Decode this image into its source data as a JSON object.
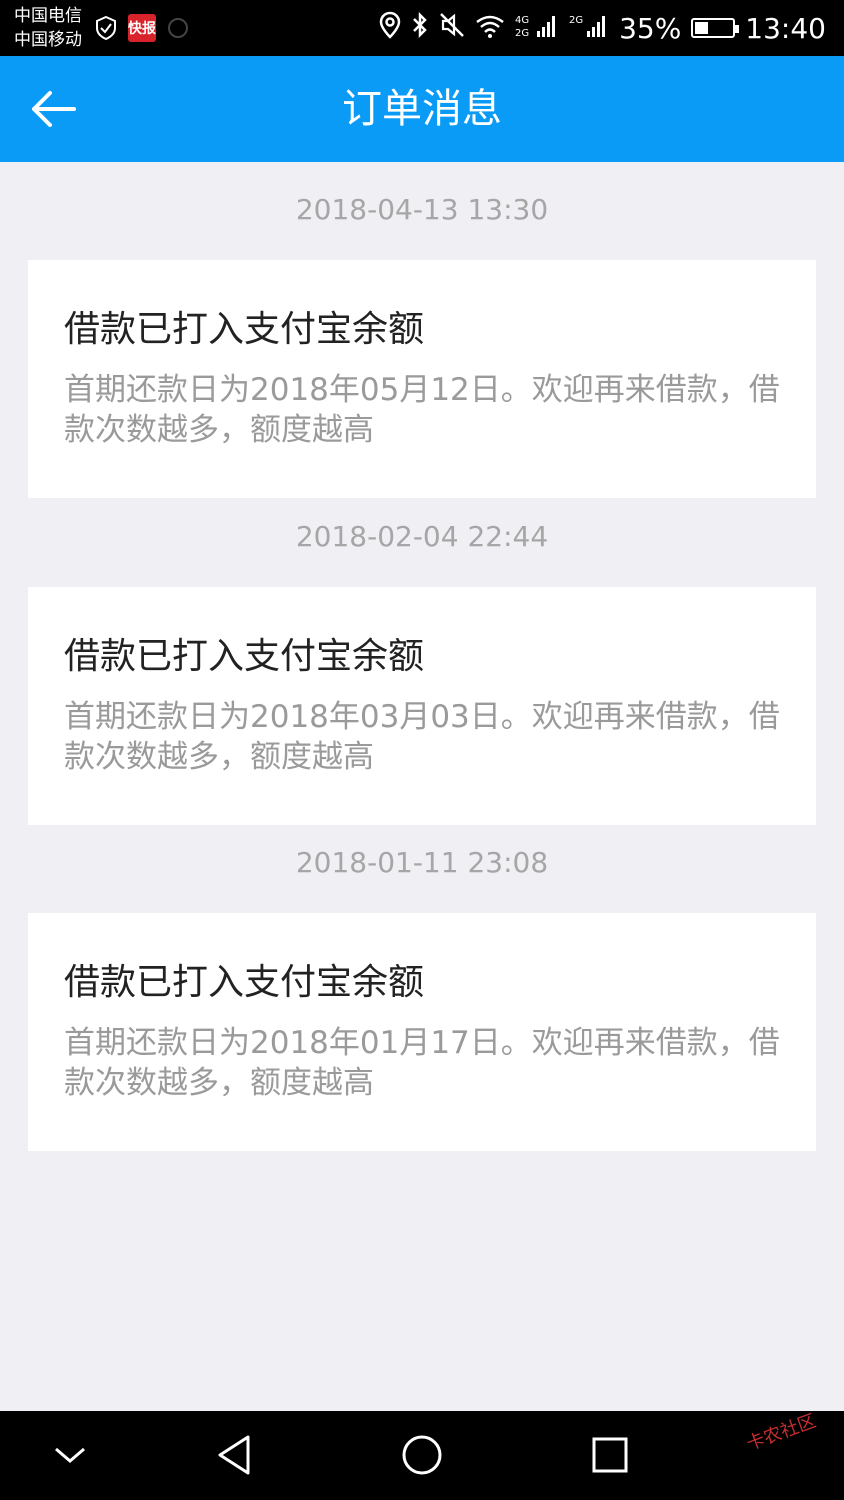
{
  "status_bar": {
    "carrier1": "中国电信",
    "carrier2": "中国移动",
    "app_badge": "快报",
    "battery_text": "35%",
    "battery_level": 0.35,
    "time": "13:40",
    "signal1_label": "4G 2G",
    "signal2_label": "2G"
  },
  "header": {
    "title": "订单消息",
    "background_color": "#0a9bf6"
  },
  "messages": [
    {
      "time": "2018-04-13 13:30",
      "title": "借款已打入支付宝余额",
      "body": "首期还款日为2018年05月12日。欢迎再来借款，借款次数越多，额度越高"
    },
    {
      "time": "2018-02-04 22:44",
      "title": "借款已打入支付宝余额",
      "body": "首期还款日为2018年03月03日。欢迎再来借款，借款次数越多，额度越高"
    },
    {
      "time": "2018-01-11 23:08",
      "title": "借款已打入支付宝余额",
      "body": "首期还款日为2018年01月17日。欢迎再来借款，借款次数越多，额度越高"
    }
  ],
  "nav_bar": {
    "icons": [
      "hide-keyboard-icon",
      "back-triangle-icon",
      "home-circle-icon",
      "recents-square-icon"
    ]
  },
  "watermark": "卡农社区"
}
